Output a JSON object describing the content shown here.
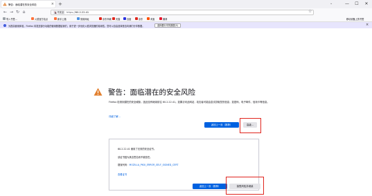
{
  "tab": {
    "title": "警告：面临潜在的安全风险",
    "close": "×",
    "new_tab": "+",
    "list_all": "⌄"
  },
  "window_controls": {
    "minimize": "—",
    "maximize": "☐",
    "close": "✕"
  },
  "nav": {
    "back": "←",
    "forward": "→",
    "reload": "↻",
    "home": "⌂",
    "not_secure_label": "不安全",
    "url_scheme": "https://",
    "url_host": "60.2.22.41",
    "bookmark_star": "☆"
  },
  "bookmarks": {
    "items": [
      {
        "label": "导入书签...",
        "color": "#9aa0a6"
      },
      {
        "label": "火狐官方站点",
        "color": "#ff7139"
      },
      {
        "label": "新手上路",
        "color": "#ff7139"
      },
      {
        "label": "常用网址",
        "color": "#4a90e2"
      },
      {
        "label": "京东商城",
        "color": "#e1251b"
      },
      {
        "label": "天猫",
        "color": "#e1251b"
      },
      {
        "label": "百度",
        "color": "#2932e1"
      },
      {
        "label": "京东",
        "color": "#e1251b"
      },
      {
        "label": "淘宝",
        "color": "#ff5000"
      },
      {
        "label": "微博",
        "color": "#e6162d"
      }
    ],
    "mobile": "移动设备上的书签"
  },
  "infobar": {
    "text": "为提高使用体验，Firefox 将发送部分功能的使用数据给我们，用于进一步优化火狐浏览器的易用性。您可以自由选择是否向我们分享数据。",
    "button": "选择要分享的数据(S)",
    "close": "×"
  },
  "warning": {
    "title": "警告：面临潜在的安全风险",
    "description": "Firefox 检测到潜在的安全威胁，因此没有继续前往 60.2.22.41。如果访问此网站，攻击者可能会尝试窃取您的信息，如密码、电子邮件、信用卡等信息。",
    "learn_more": "详细了解...",
    "go_back": "返回上一页（推荐）",
    "advanced": "高级..."
  },
  "advanced_panel": {
    "line1": "60.2.22.41 使用了无效的安全证书。",
    "line2": "该证书因为其自签名而不被信任。",
    "error_prefix": "错误代码：",
    "error_code": "MOZILLA_PKIX_ERROR_SELF_SIGNED_CERT",
    "view_cert": "查看证书",
    "go_back": "返回上一页（推荐）",
    "accept": "接受风险并继续"
  },
  "colors": {
    "accent": "#0061e0",
    "highlight": "#e0241d",
    "warning": "#e27f2e"
  }
}
